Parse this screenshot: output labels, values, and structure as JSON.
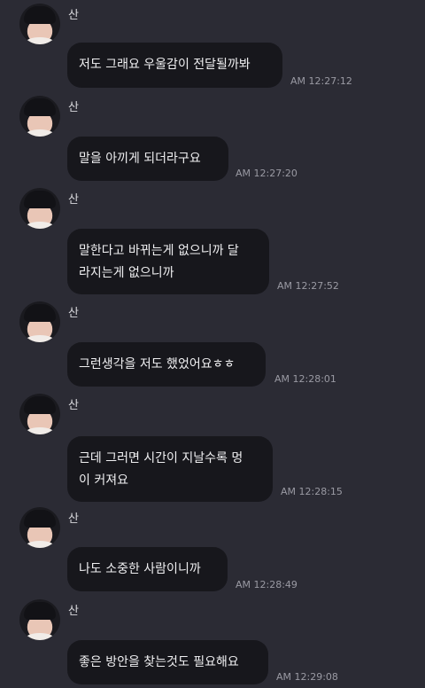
{
  "messages": [
    {
      "sender": "산",
      "text": "저도 그래요 우울감이 전달될까봐",
      "time": "AM 12:27:12"
    },
    {
      "sender": "산",
      "text": "말을 아끼게 되더라구요",
      "time": "AM 12:27:20"
    },
    {
      "sender": "산",
      "line1": "말한다고 바뀌는게 없으니까 달",
      "line2": "라지는게 없으니까",
      "time": "AM 12:27:52"
    },
    {
      "sender": "산",
      "text": "그런생각을 저도 했었어요ㅎㅎ",
      "time": "AM 12:28:01"
    },
    {
      "sender": "산",
      "line1": "근데 그러면 시간이 지날수록 멍",
      "line2": "이 커져요",
      "time": "AM 12:28:15"
    },
    {
      "sender": "산",
      "text": "나도 소중한 사람이니까",
      "time": "AM 12:28:49"
    },
    {
      "sender": "산",
      "text": "좋은 방안을 찾는것도 필요해요",
      "time": "AM 12:29:08"
    }
  ]
}
